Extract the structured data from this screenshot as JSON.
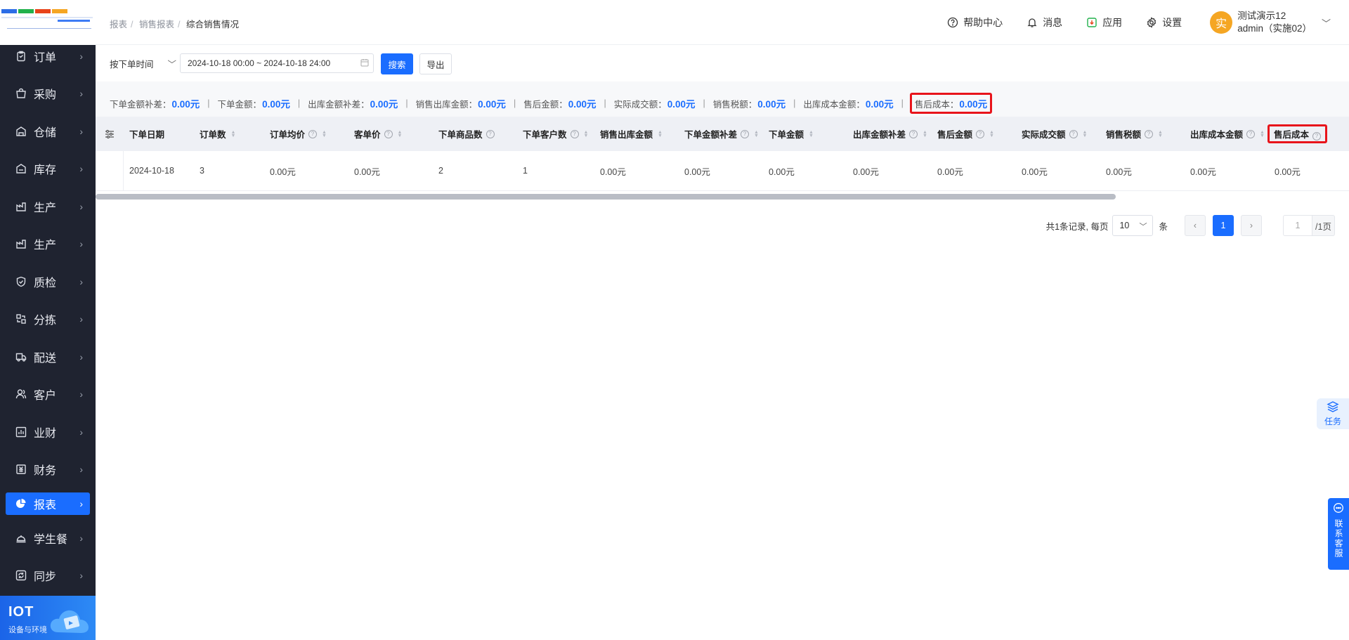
{
  "sidebar": {
    "items": [
      {
        "label": "订单",
        "icon": "order-icon"
      },
      {
        "label": "采购",
        "icon": "purchase-icon"
      },
      {
        "label": "仓储",
        "icon": "warehouse-icon"
      },
      {
        "label": "库存",
        "icon": "inventory-icon"
      },
      {
        "label": "生产",
        "icon": "production-icon"
      },
      {
        "label": "生产",
        "icon": "production-icon"
      },
      {
        "label": "质检",
        "icon": "quality-check-icon"
      },
      {
        "label": "分拣",
        "icon": "sorting-icon"
      },
      {
        "label": "配送",
        "icon": "delivery-truck-icon"
      },
      {
        "label": "客户",
        "icon": "customer-icon"
      },
      {
        "label": "业财",
        "icon": "business-finance-icon"
      },
      {
        "label": "财务",
        "icon": "finance-icon"
      },
      {
        "label": "报表",
        "icon": "report-pie-icon",
        "active": true
      },
      {
        "label": "学生餐",
        "icon": "meal-icon"
      },
      {
        "label": "同步",
        "icon": "sync-icon"
      }
    ],
    "iot": {
      "title": "IOT",
      "subtitle": "设备与环境"
    }
  },
  "header": {
    "breadcrumb": [
      "报表",
      "销售报表",
      "综合销售情况"
    ],
    "help": "帮助中心",
    "messages": "消息",
    "apps": "应用",
    "settings": "设置",
    "user": {
      "avatar": "实",
      "name": "测试演示12",
      "account": "admin（实施02）"
    }
  },
  "filter": {
    "time_type": "按下单时间",
    "date_range": "2024-10-18 00:00 ~ 2024-10-18 24:00",
    "search": "搜索",
    "export": "导出"
  },
  "summary": [
    {
      "label": "下单金额补差：",
      "value": "0.00元"
    },
    {
      "label": "下单金额：",
      "value": "0.00元"
    },
    {
      "label": "出库金额补差：",
      "value": "0.00元"
    },
    {
      "label": "销售出库金额：",
      "value": "0.00元"
    },
    {
      "label": "售后金额：",
      "value": "0.00元"
    },
    {
      "label": "实际成交额：",
      "value": "0.00元"
    },
    {
      "label": "销售税额：",
      "value": "0.00元"
    },
    {
      "label": "出库成本金额：",
      "value": "0.00元"
    },
    {
      "label": "售后成本：",
      "value": "0.00元",
      "highlighted": true
    }
  ],
  "table": {
    "columns": [
      {
        "label": "下单日期",
        "help": false,
        "sort": false
      },
      {
        "label": "订单数",
        "help": false,
        "sort": true
      },
      {
        "label": "订单均价",
        "help": true,
        "sort": true
      },
      {
        "label": "客单价",
        "help": true,
        "sort": true
      },
      {
        "label": "下单商品数",
        "help": true,
        "sort": false
      },
      {
        "label": "下单客户数",
        "help": true,
        "sort": true
      },
      {
        "label": "销售出库金额",
        "help": false,
        "sort": true
      },
      {
        "label": "下单金额补差",
        "help": true,
        "sort": true
      },
      {
        "label": "下单金额",
        "help": false,
        "sort": true
      },
      {
        "label": "出库金额补差",
        "help": true,
        "sort": true
      },
      {
        "label": "售后金额",
        "help": true,
        "sort": true
      },
      {
        "label": "实际成交额",
        "help": true,
        "sort": true
      },
      {
        "label": "销售税额",
        "help": true,
        "sort": true
      },
      {
        "label": "出库成本金额",
        "help": true,
        "sort": true
      },
      {
        "label": "售后成本",
        "help": true,
        "sort": false,
        "highlighted": true
      }
    ],
    "rows": [
      [
        "2024-10-18",
        "3",
        "0.00元",
        "0.00元",
        "2",
        "1",
        "0.00元",
        "0.00元",
        "0.00元",
        "0.00元",
        "0.00元",
        "0.00元",
        "0.00元",
        "0.00元",
        "0.00元"
      ]
    ]
  },
  "pagination": {
    "total_text": "共1条记录, 每页",
    "page_size": "10",
    "unit": "条",
    "prev": "‹",
    "current": "1",
    "next": "›",
    "goto": "1",
    "total_pages": "/1页"
  },
  "floating": {
    "task": "任务",
    "contact": "联系客服"
  },
  "colors": {
    "accent": "#1a6dff",
    "sidebar_bg": "#1f2330",
    "highlight": "#e8141b",
    "avatar": "#f5a623"
  }
}
